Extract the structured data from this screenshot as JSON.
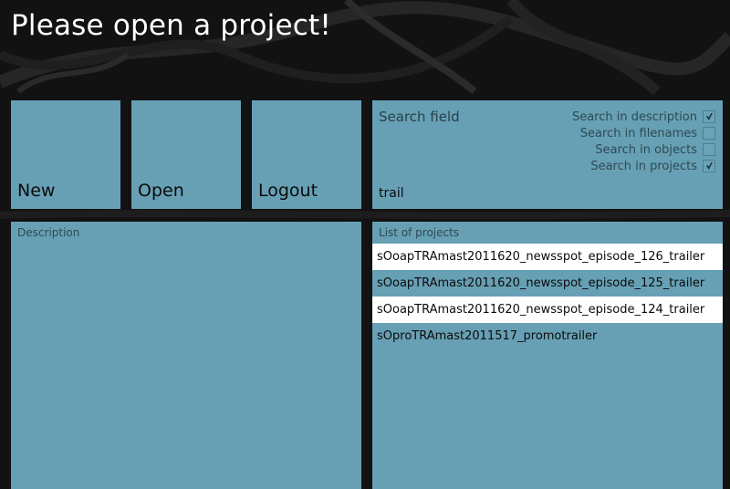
{
  "page": {
    "title": "Please open a project!"
  },
  "tiles": {
    "new": "New",
    "open": "Open",
    "logout": "Logout"
  },
  "search": {
    "title": "Search field",
    "value": "trail",
    "options": [
      {
        "label": "Search in description",
        "checked": true
      },
      {
        "label": "Search in filenames",
        "checked": false
      },
      {
        "label": "Search in objects",
        "checked": false
      },
      {
        "label": "Search in projects",
        "checked": true
      }
    ]
  },
  "description": {
    "title": "Description"
  },
  "projects": {
    "title": "List of projects",
    "items": [
      "sOoapTRAmast2011620_newsspot_episode_126_trailer",
      "sOoapTRAmast2011620_newsspot_episode_125_trailer",
      "sOoapTRAmast2011620_newsspot_episode_124_trailer",
      "sOproTRAmast2011517_promotrailer"
    ]
  },
  "colors": {
    "tile": "#67a0b4",
    "background": "#121212",
    "row_highlight": "#ffffff"
  }
}
